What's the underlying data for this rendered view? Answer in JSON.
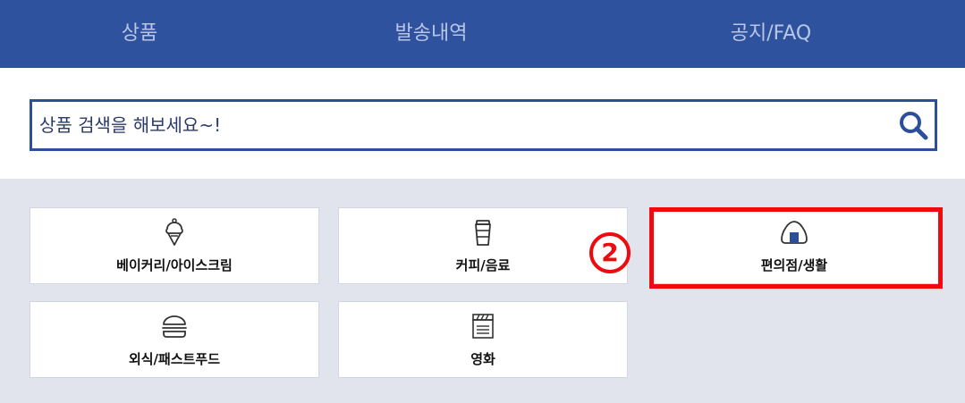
{
  "nav": {
    "tabs": [
      {
        "label": "상품"
      },
      {
        "label": "발송내역"
      },
      {
        "label": "공지/FAQ"
      }
    ]
  },
  "search": {
    "placeholder": "상품 검색을 해보세요~!"
  },
  "categories": [
    {
      "label": "베이커리/아이스크림",
      "icon": "ice-cream-icon"
    },
    {
      "label": "커피/음료",
      "icon": "coffee-cup-icon"
    },
    {
      "label": "편의점/생활",
      "icon": "rice-ball-icon"
    },
    {
      "label": "외식/패스트푸드",
      "icon": "burger-icon"
    },
    {
      "label": "영화",
      "icon": "clapperboard-icon"
    }
  ],
  "annotation": {
    "badge": "2"
  },
  "colors": {
    "nav_bg": "#2f529f",
    "accent": "#2d4e99",
    "highlight": "#ef0a10",
    "content_bg": "#e1e4ec"
  }
}
